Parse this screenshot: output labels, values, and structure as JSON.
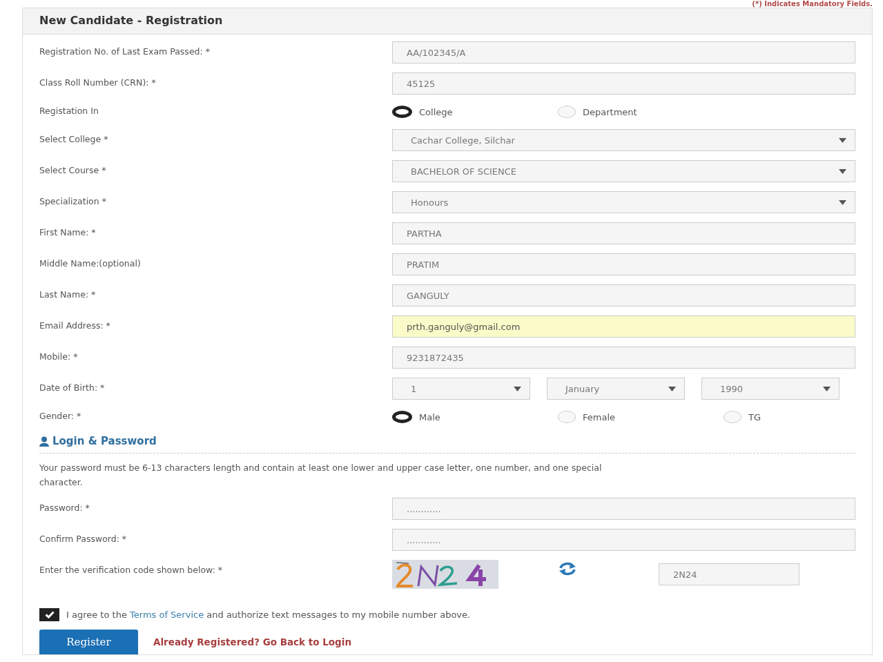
{
  "mandatory_note": "(*) Indicates Mandatory Fields.",
  "panel": {
    "title": "New Candidate - Registration"
  },
  "fields": [
    {
      "kind": "text",
      "label": "Registration No. of Last Exam Passed: *",
      "value": "AA/102345/A",
      "highlighted": false
    },
    {
      "kind": "text",
      "label": "Class Roll Number (CRN): *",
      "value": "45125",
      "highlighted": false
    },
    {
      "kind": "radio",
      "label": "Registation In",
      "options": [
        {
          "label": "College",
          "selected": true
        },
        {
          "label": "Department",
          "selected": false
        }
      ]
    },
    {
      "kind": "select",
      "label": "Select College *",
      "value": "Cachar College, Silchar"
    },
    {
      "kind": "select",
      "label": "Select Course *",
      "value": "BACHELOR OF SCIENCE"
    },
    {
      "kind": "select",
      "label": "Specialization *",
      "value": "Honours"
    },
    {
      "kind": "text",
      "label": "First Name: *",
      "value": "PARTHA",
      "highlighted": false
    },
    {
      "kind": "text",
      "label": "Middle Name:(optional)",
      "value": "PRATIM",
      "highlighted": false
    },
    {
      "kind": "text",
      "label": "Last Name: *",
      "value": "GANGULY",
      "highlighted": false
    },
    {
      "kind": "text",
      "label": "Email Address: *",
      "value": "prth.ganguly@gmail.com",
      "highlighted": true
    },
    {
      "kind": "text",
      "label": "Mobile: *",
      "value": "9231872435",
      "highlighted": false
    },
    {
      "kind": "date",
      "label": "Date of Birth: *",
      "parts": [
        "1",
        "January",
        "1990"
      ]
    },
    {
      "kind": "radio",
      "label": "Gender: *",
      "options": [
        {
          "label": "Male",
          "selected": true
        },
        {
          "label": "Female",
          "selected": false
        },
        {
          "label": "TG",
          "selected": false
        }
      ]
    }
  ],
  "login_section": {
    "title": "Login & Password",
    "note": "Your password must be 6-13 characters length and contain at least one lower and upper case letter, one number, and one special character.",
    "fields": [
      {
        "kind": "password",
        "label": "Password: *",
        "value": "............"
      },
      {
        "kind": "password",
        "label": "Confirm Password: *",
        "value": "............"
      },
      {
        "kind": "captcha",
        "label": "Enter the verification code shown below: *",
        "value": "2N24"
      }
    ]
  },
  "agreement": {
    "checked": true,
    "before": "I agree to the",
    "link": "Terms of Service",
    "after": "and authorize text messages to my mobile number above."
  },
  "register_button": "Register",
  "login_link": "Already Registered? Go Back to Login"
}
